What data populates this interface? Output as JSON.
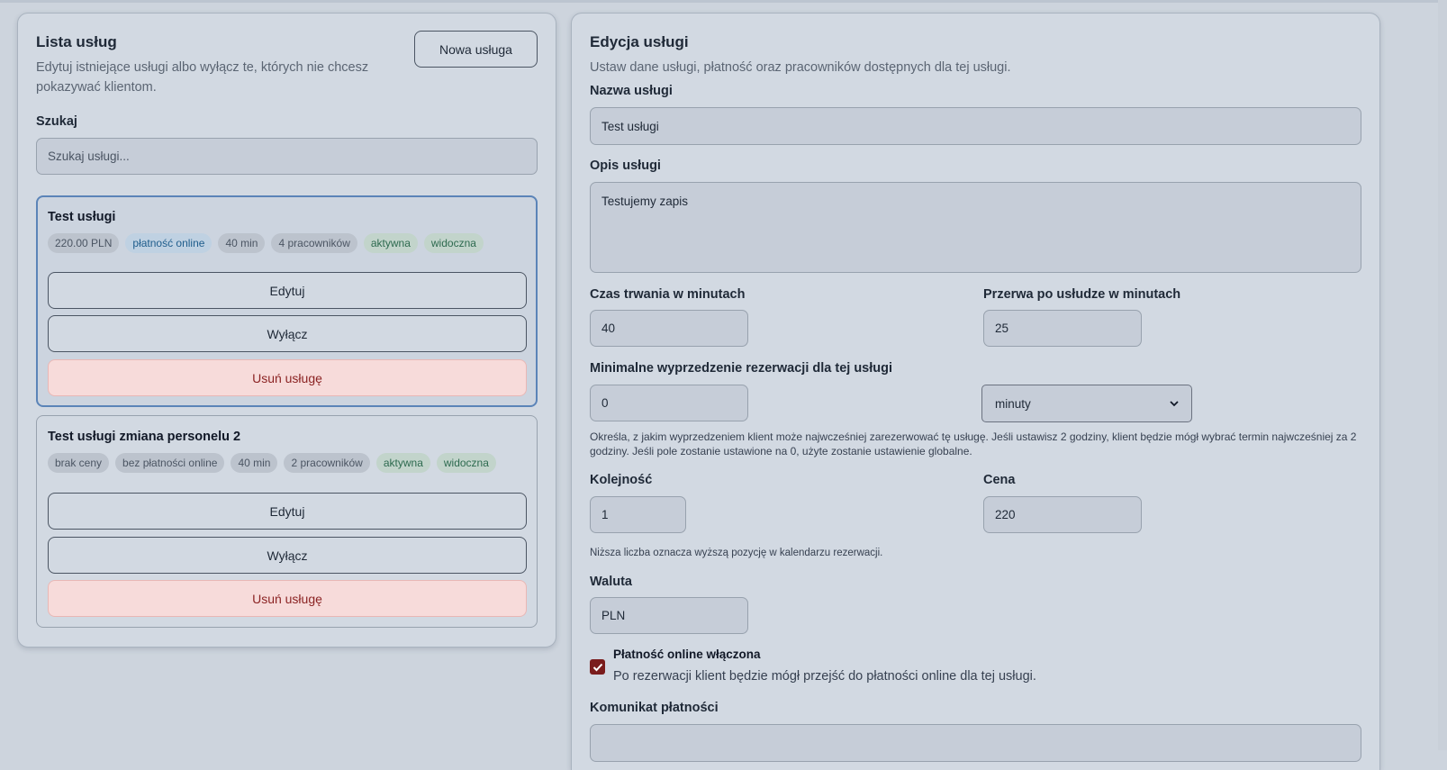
{
  "list": {
    "title": "Lista usług",
    "description": "Edytuj istniejące usługi albo wyłącz te, których nie chcesz pokazywać klientom.",
    "new_button": "Nowa usługa",
    "search_label": "Szukaj",
    "search_placeholder": "Szukaj usługi...",
    "services": [
      {
        "name": "Test usługi",
        "badges": [
          "220.00 PLN",
          "płatność online",
          "40 min",
          "4 pracowników",
          "aktywna",
          "widoczna"
        ],
        "edit_label": "Edytuj",
        "disable_label": "Wyłącz",
        "delete_label": "Usuń usługę"
      },
      {
        "name": "Test usługi zmiana personelu 2",
        "badges": [
          "brak ceny",
          "bez płatności online",
          "40 min",
          "2 pracowników",
          "aktywna",
          "widoczna"
        ],
        "edit_label": "Edytuj",
        "disable_label": "Wyłącz",
        "delete_label": "Usuń usługę"
      }
    ]
  },
  "edit": {
    "title": "Edycja usługi",
    "description": "Ustaw dane usługi, płatność oraz pracowników dostępnych dla tej usługi.",
    "name_label": "Nazwa usługi",
    "name_value": "Test usługi",
    "desc_label": "Opis usługi",
    "desc_value": "Testujemy zapis",
    "duration_label": "Czas trwania w minutach",
    "duration_value": "40",
    "break_label": "Przerwa po usłudze w minutach",
    "break_value": "25",
    "lead_label": "Minimalne wyprzedzenie rezerwacji dla tej usługi",
    "lead_value": "0",
    "lead_unit": "minuty",
    "lead_hint": "Określa, z jakim wyprzedzeniem klient może najwcześniej zarezerwować tę usługę. Jeśli ustawisz 2 godziny, klient będzie mógł wybrać termin najwcześniej za 2 godziny. Jeśli pole zostanie ustawione na 0, użyte zostanie ustawienie globalne.",
    "order_label": "Kolejność",
    "order_value": "1",
    "order_hint": "Niższa liczba oznacza wyższą pozycję w kalendarzu rezerwacji.",
    "price_label": "Cena",
    "price_value": "220",
    "currency_label": "Waluta",
    "currency_value": "PLN",
    "online_payment_label": "Płatność online włączona",
    "online_payment_desc": "Po rezerwacji klient będzie mógł przejść do płatności online dla tej usługi.",
    "online_payment_checked": true,
    "payment_message_label": "Komunikat płatności"
  }
}
